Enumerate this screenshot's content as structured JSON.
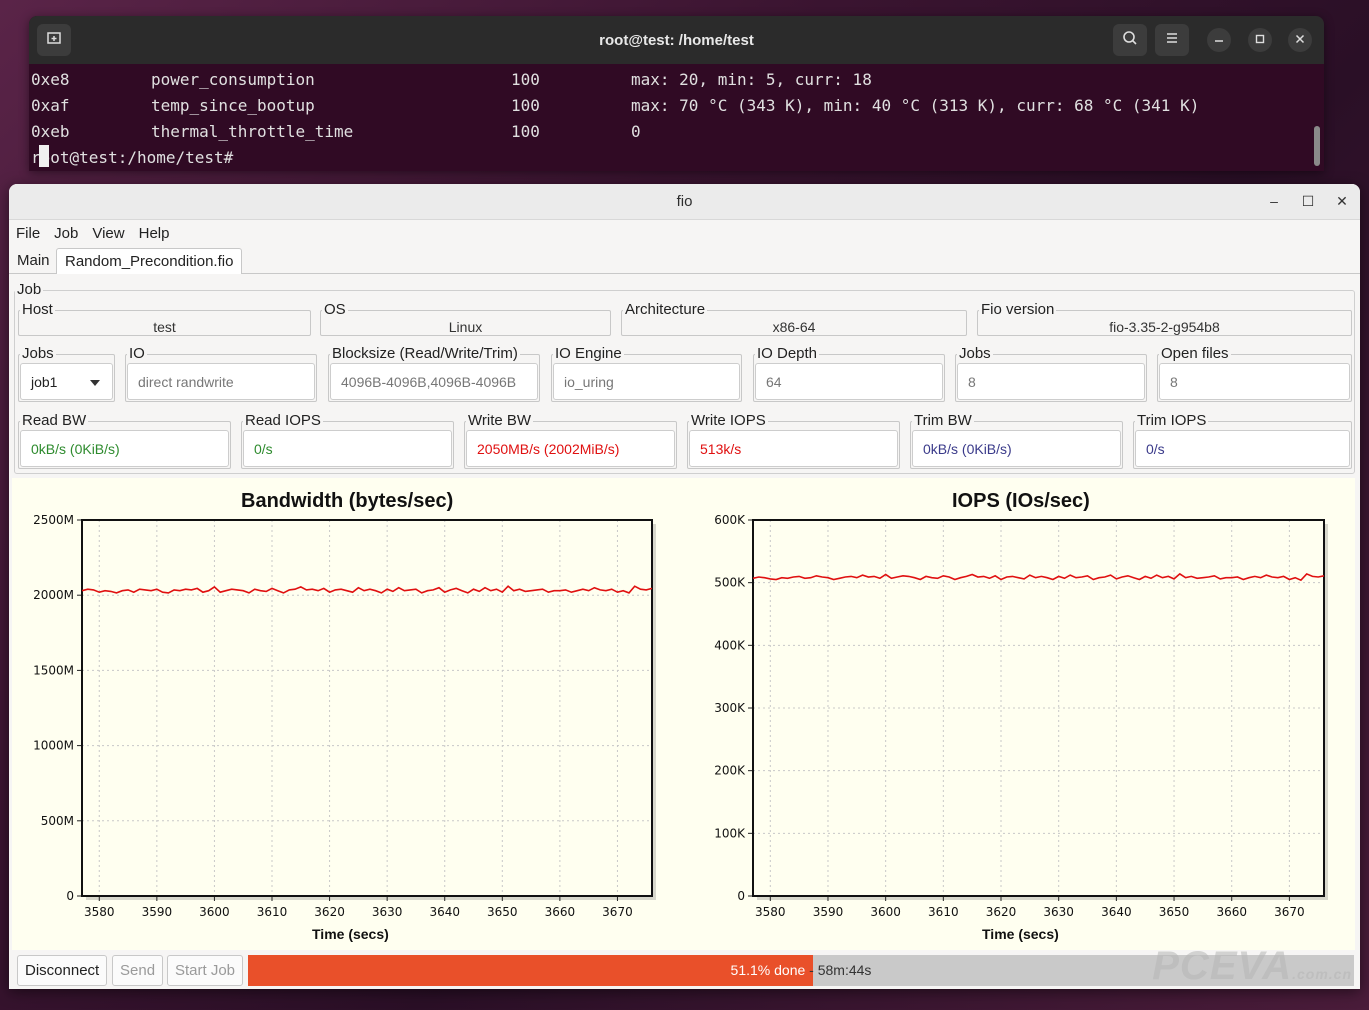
{
  "terminal": {
    "title": "root@test: /home/test",
    "rows": [
      {
        "id": "0xe8",
        "name": "power_consumption",
        "norm": "100",
        "value": "max: 20, min: 5, curr: 18"
      },
      {
        "id": "0xaf",
        "name": "temp_since_bootup",
        "norm": "100",
        "value": "max: 70 °C (343 K), min: 40 °C (313 K), curr: 68 °C (341 K)"
      },
      {
        "id": "0xeb",
        "name": "thermal_throttle_time",
        "norm": "100",
        "value": "0"
      }
    ],
    "prompt": "root@test:/home/test#"
  },
  "fio": {
    "window_title": "fio",
    "menu": [
      "File",
      "Job",
      "View",
      "Help"
    ],
    "tabs": [
      "Main",
      "Random_Precondition.fio"
    ],
    "job": {
      "legend": "Job",
      "host": {
        "label": "Host",
        "value": "test"
      },
      "os": {
        "label": "OS",
        "value": "Linux"
      },
      "arch": {
        "label": "Architecture",
        "value": "x86-64"
      },
      "fio_version": {
        "label": "Fio version",
        "value": "fio-3.35-2-g954b8"
      },
      "jobs_select": {
        "label": "Jobs",
        "value": "job1"
      },
      "io": {
        "label": "IO",
        "value": "direct randwrite"
      },
      "blocksize": {
        "label": "Blocksize (Read/Write/Trim)",
        "value": "4096B-4096B,4096B-4096B"
      },
      "io_engine": {
        "label": "IO Engine",
        "value": "io_uring"
      },
      "io_depth": {
        "label": "IO Depth",
        "value": "64"
      },
      "jobs": {
        "label": "Jobs",
        "value": "8"
      },
      "open_files": {
        "label": "Open files",
        "value": "8"
      },
      "read_bw": {
        "label": "Read BW",
        "value": "0kB/s (0KiB/s)"
      },
      "read_iops": {
        "label": "Read IOPS",
        "value": "0/s"
      },
      "write_bw": {
        "label": "Write BW",
        "value": "2050MB/s (2002MiB/s)"
      },
      "write_iops": {
        "label": "Write IOPS",
        "value": "513k/s"
      },
      "trim_bw": {
        "label": "Trim BW",
        "value": "0kB/s (0KiB/s)"
      },
      "trim_iops": {
        "label": "Trim IOPS",
        "value": "0/s"
      }
    },
    "buttons": {
      "disconnect": "Disconnect",
      "send": "Send",
      "start_job": "Start Job"
    },
    "progress": {
      "fraction": 0.511,
      "done_text": "51.1% done",
      "remaining": "58m:44s"
    },
    "watermark": "PCEVA.com.cn"
  },
  "colors": {
    "read": "#2e8b2e",
    "write": "#e01010",
    "trim": "#3a3a8a",
    "progress": "#e9502a"
  },
  "chart_data": [
    {
      "type": "line",
      "title": "Bandwidth (bytes/sec)",
      "xlabel": "Time (secs)",
      "ylabel": "",
      "xlim": [
        3577,
        3676
      ],
      "ylim": [
        0,
        2500
      ],
      "x_ticks": [
        3580,
        3590,
        3600,
        3610,
        3620,
        3630,
        3640,
        3650,
        3660,
        3670
      ],
      "y_ticks": [
        0,
        500,
        1000,
        1500,
        2000,
        2500
      ],
      "y_tick_labels": [
        "0",
        "500M",
        "1000M",
        "1500M",
        "2000M",
        "2500M"
      ],
      "grid": true,
      "series": [
        {
          "color": "#e01010",
          "x_start": 3577,
          "x_step": 1,
          "values": [
            2030,
            2040,
            2035,
            2020,
            2030,
            2025,
            2015,
            2030,
            2035,
            2020,
            2040,
            2035,
            2030,
            2040,
            2020,
            2015,
            2035,
            2030,
            2040,
            2035,
            2045,
            2020,
            2030,
            2055,
            2020,
            2030,
            2040,
            2035,
            2030,
            2015,
            2040,
            2030,
            2025,
            2045,
            2030,
            2015,
            2035,
            2040,
            2055,
            2035,
            2040,
            2030,
            2045,
            2020,
            2035,
            2040,
            2030,
            2020,
            2050,
            2030,
            2040,
            2030,
            2015,
            2040,
            2025,
            2050,
            2030,
            2035,
            2040,
            2015,
            2030,
            2035,
            2050,
            2020,
            2035,
            2045,
            2030,
            2015,
            2040,
            2025,
            2050,
            2030,
            2040,
            2020,
            2060,
            2030,
            2040,
            2025,
            2030,
            2035,
            2040,
            2020,
            2030,
            2030,
            2035,
            2020,
            2030,
            2040,
            2030,
            2050,
            2035,
            2030,
            2040,
            2020,
            2030,
            2015,
            2060,
            2040,
            2035,
            2045
          ]
        }
      ]
    },
    {
      "type": "line",
      "title": "IOPS (IOs/sec)",
      "xlabel": "Time (secs)",
      "ylabel": "",
      "xlim": [
        3577,
        3676
      ],
      "ylim": [
        0,
        600
      ],
      "x_ticks": [
        3580,
        3590,
        3600,
        3610,
        3620,
        3630,
        3640,
        3650,
        3660,
        3670
      ],
      "y_ticks": [
        0,
        100,
        200,
        300,
        400,
        500,
        600
      ],
      "y_tick_labels": [
        "0",
        "100K",
        "200K",
        "300K",
        "400K",
        "500K",
        "600K"
      ],
      "grid": true,
      "series": [
        {
          "color": "#e01010",
          "x_start": 3577,
          "x_step": 1,
          "values": [
            507,
            509,
            508,
            506,
            505,
            508,
            507,
            509,
            510,
            507,
            508,
            511,
            509,
            508,
            505,
            507,
            509,
            510,
            508,
            512,
            509,
            510,
            507,
            513,
            507,
            509,
            511,
            510,
            508,
            505,
            510,
            508,
            507,
            511,
            509,
            505,
            508,
            510,
            513,
            509,
            510,
            507,
            511,
            505,
            509,
            510,
            508,
            506,
            512,
            508,
            510,
            508,
            505,
            510,
            507,
            512,
            508,
            509,
            511,
            505,
            508,
            509,
            512,
            506,
            509,
            511,
            508,
            505,
            510,
            507,
            512,
            508,
            510,
            506,
            514,
            508,
            510,
            507,
            508,
            509,
            511,
            506,
            508,
            508,
            509,
            505,
            508,
            510,
            508,
            512,
            509,
            508,
            510,
            505,
            508,
            504,
            514,
            510,
            509,
            511
          ]
        }
      ]
    }
  ]
}
